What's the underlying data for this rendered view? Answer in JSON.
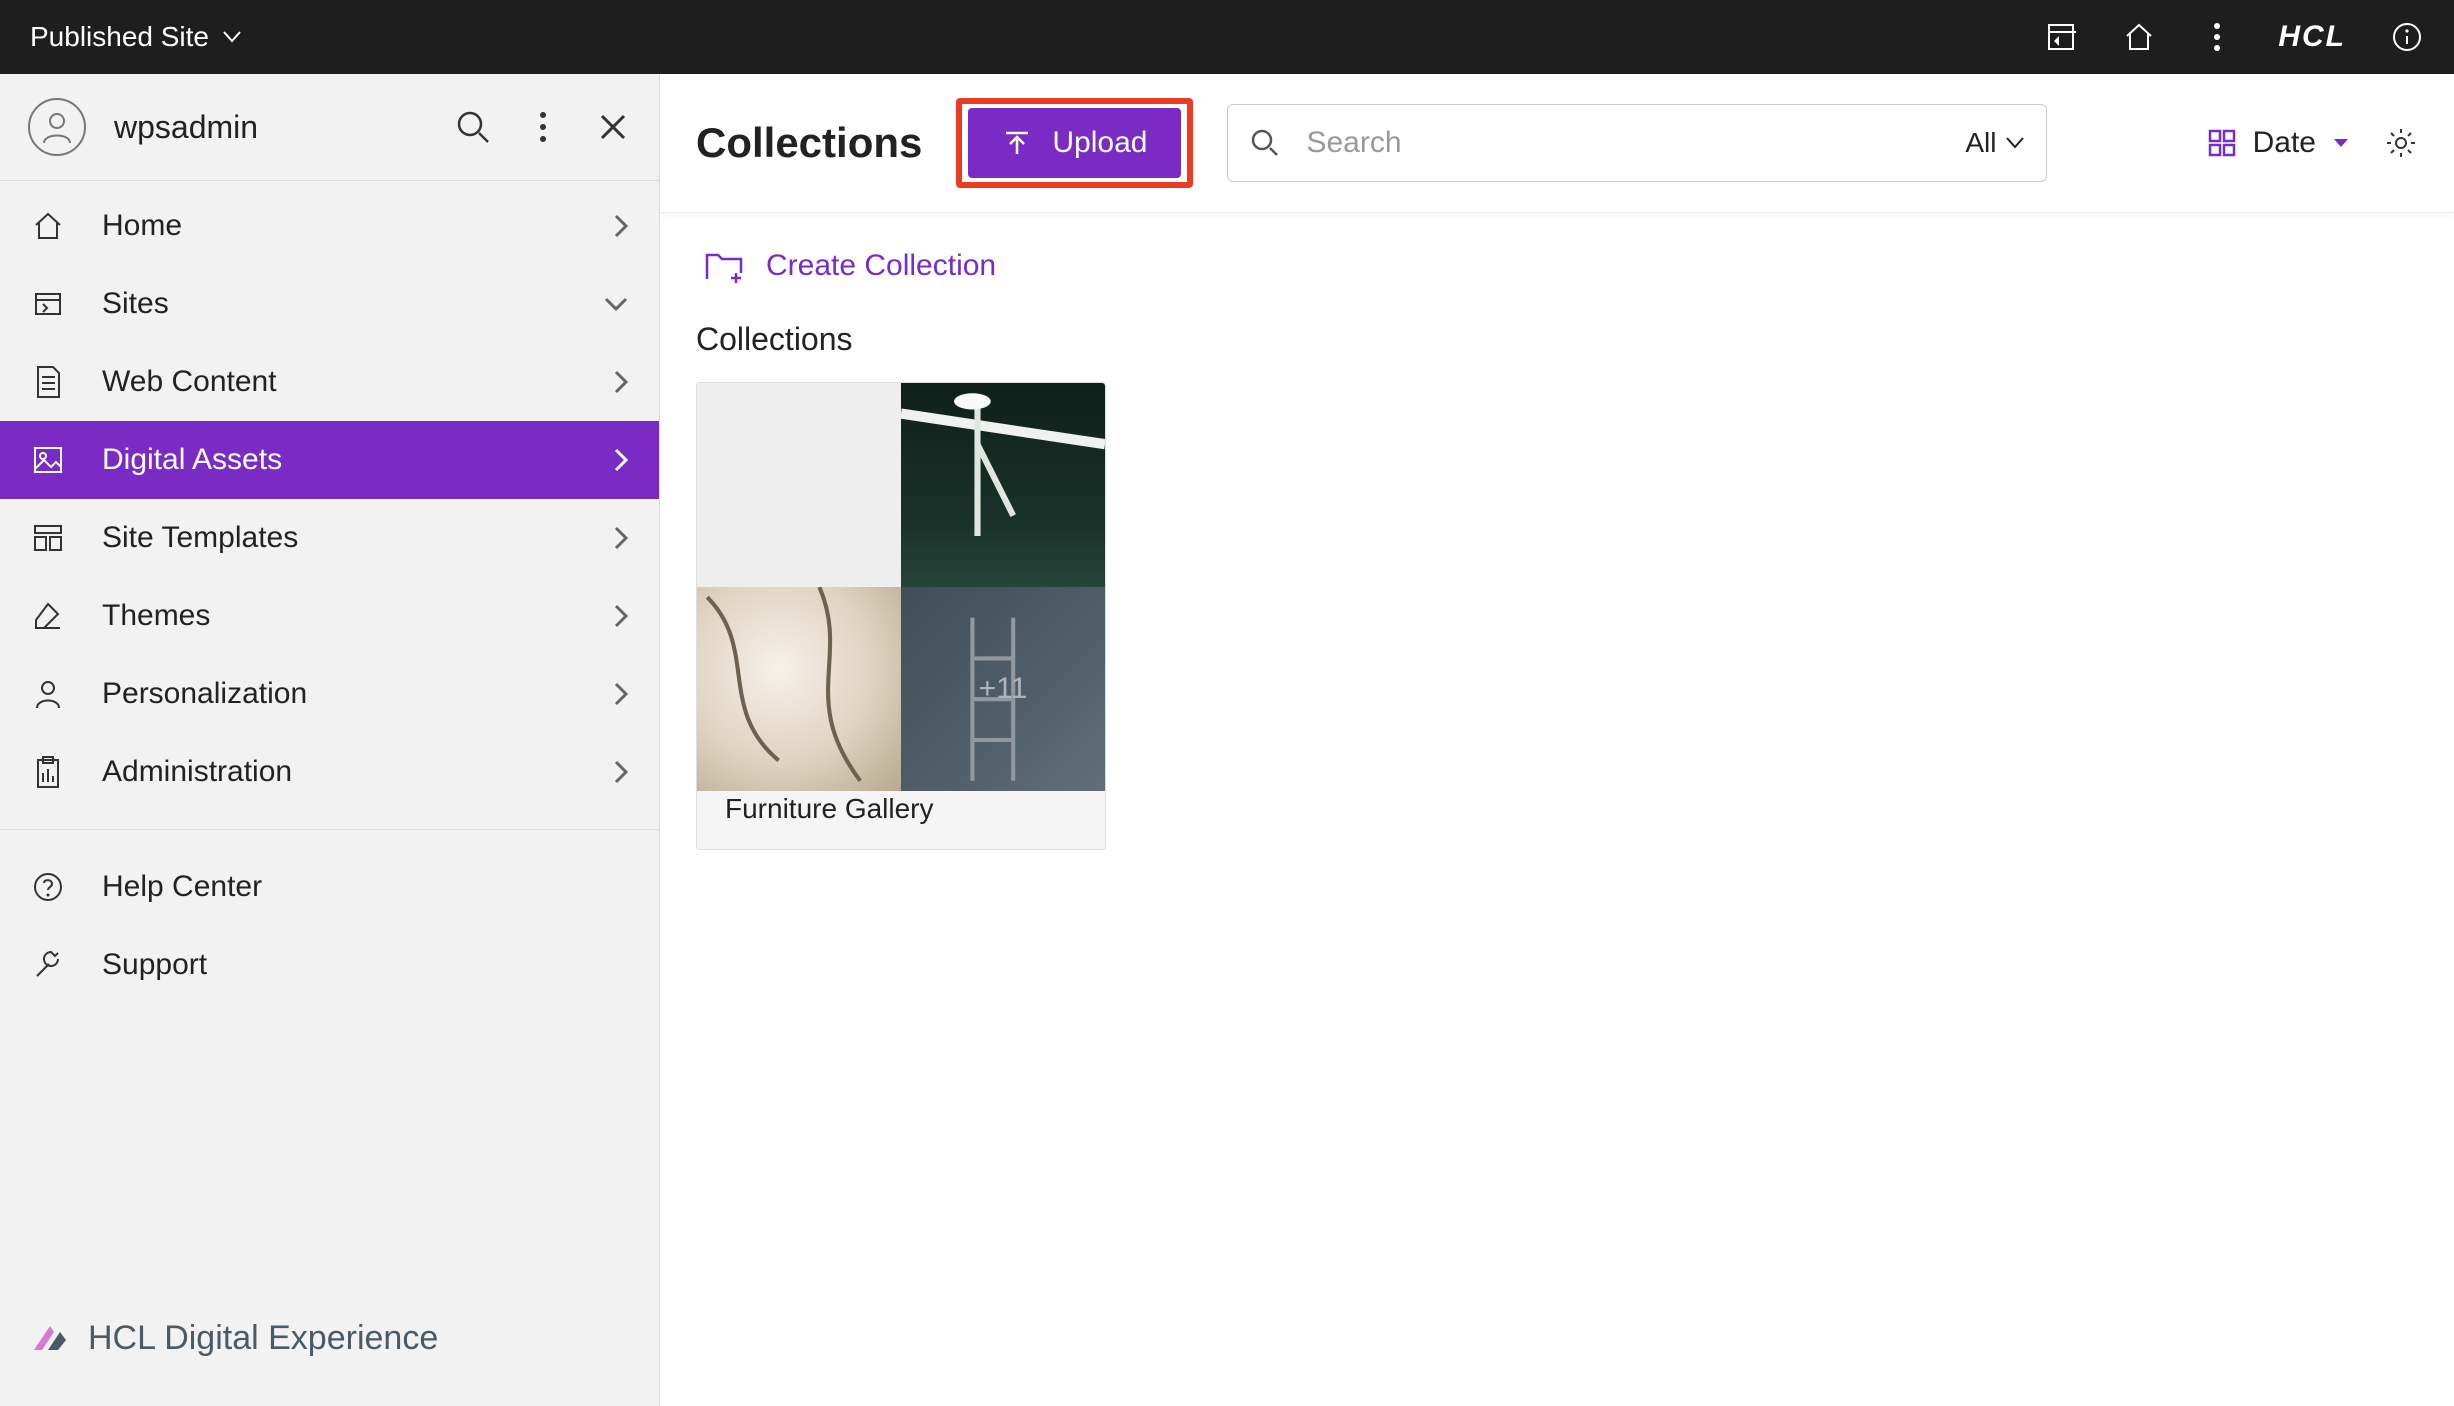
{
  "topbar": {
    "site_label": "Published Site",
    "brand": "HCL"
  },
  "sidebar": {
    "username": "wpsadmin",
    "items": [
      {
        "label": "Home"
      },
      {
        "label": "Sites"
      },
      {
        "label": "Web Content"
      },
      {
        "label": "Digital Assets"
      },
      {
        "label": "Site Templates"
      },
      {
        "label": "Themes"
      },
      {
        "label": "Personalization"
      },
      {
        "label": "Administration"
      }
    ],
    "help": [
      {
        "label": "Help Center"
      },
      {
        "label": "Support"
      }
    ],
    "footer": "HCL Digital Experience"
  },
  "toolbar": {
    "title": "Collections",
    "upload_label": "Upload",
    "search_placeholder": "Search",
    "filter_label": "All",
    "sort_label": "Date"
  },
  "body": {
    "create_label": "Create Collection",
    "section_title": "Collections",
    "cards": [
      {
        "label": "Furniture Gallery",
        "extra_count": "+11"
      }
    ]
  }
}
